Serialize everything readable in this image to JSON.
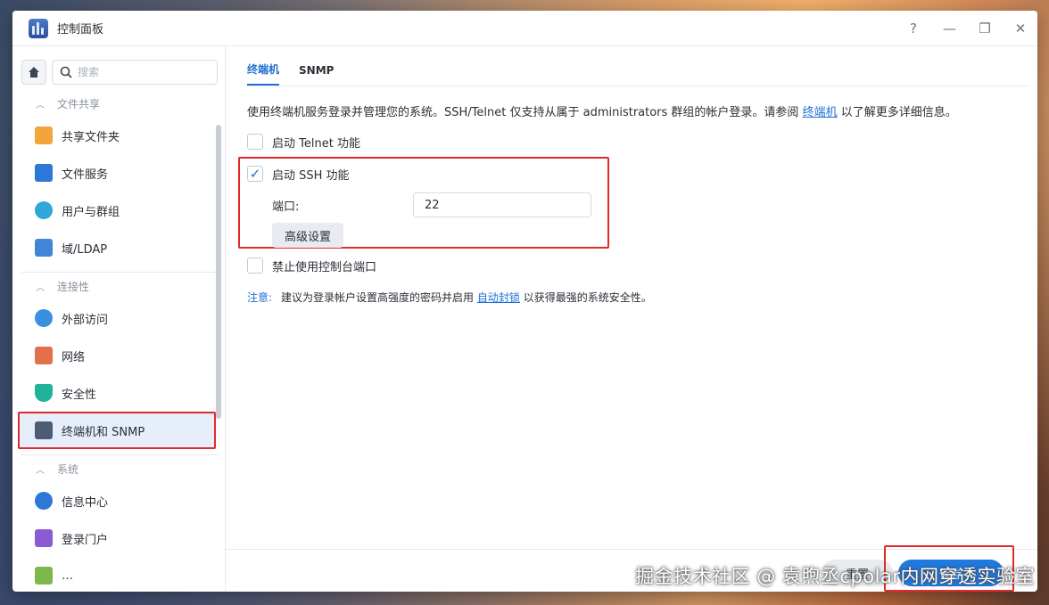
{
  "window": {
    "title": "控制面板",
    "controls": {
      "help": "?",
      "minimize": "—",
      "maximize": "❐",
      "close": "✕"
    }
  },
  "sidebar": {
    "search_placeholder": "搜索",
    "sections": [
      {
        "label": "文件共享",
        "items": [
          "共享文件夹",
          "文件服务",
          "用户与群组",
          "域/LDAP"
        ]
      },
      {
        "label": "连接性",
        "items": [
          "外部访问",
          "网络",
          "安全性",
          "终端机和 SNMP"
        ]
      },
      {
        "label": "系统",
        "items": [
          "信息中心",
          "登录门户",
          "…"
        ]
      }
    ]
  },
  "main": {
    "tabs": [
      "终端机",
      "SNMP"
    ],
    "description": {
      "before": "使用终端机服务登录并管理您的系统。SSH/Telnet 仅支持从属于 administrators 群组的帐户登录。请参阅 ",
      "link": "终端机",
      "after": " 以了解更多详细信息。"
    },
    "telnet_label": "启动 Telnet 功能",
    "ssh_label": "启动 SSH 功能",
    "port_label": "端口:",
    "port_value": "22",
    "advanced_button": "高级设置",
    "console_label": "禁止使用控制台端口",
    "note": {
      "label": "注意:",
      "before": "建议为登录帐户设置高强度的密码并启用 ",
      "link": "自动封锁",
      "after": " 以获得最强的系统安全性。"
    }
  },
  "footer": {
    "reset_button": "重置",
    "save_button": "保存"
  },
  "watermark": "掘金技术社区 @ 袁煦丞cpolar内网穿透实验室",
  "colors": {
    "accent": "#1f6fd0",
    "highlight": "#e02a2a",
    "save": "#1f7ae0"
  }
}
